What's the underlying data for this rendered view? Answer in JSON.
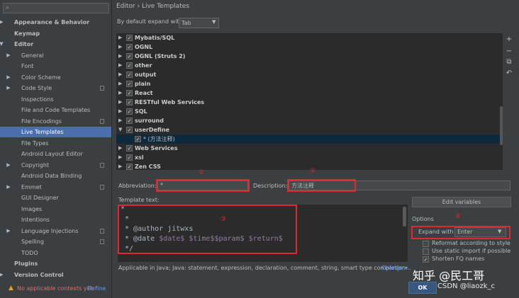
{
  "sidebar": {
    "search_icon": "magnifier-icon",
    "items": [
      {
        "label": "Appearance & Behavior",
        "arrow": "▶"
      },
      {
        "label": "Keymap",
        "arrow": ""
      },
      {
        "label": "Editor",
        "arrow": "▼"
      },
      {
        "label": "General",
        "arrow": "▶"
      },
      {
        "label": "Font",
        "arrow": ""
      },
      {
        "label": "Color Scheme",
        "arrow": "▶"
      },
      {
        "label": "Code Style",
        "arrow": "▶"
      },
      {
        "label": "Inspections",
        "arrow": ""
      },
      {
        "label": "File and Code Templates",
        "arrow": ""
      },
      {
        "label": "File Encodings",
        "arrow": ""
      },
      {
        "label": "Live Templates",
        "arrow": ""
      },
      {
        "label": "File Types",
        "arrow": ""
      },
      {
        "label": "Android Layout Editor",
        "arrow": ""
      },
      {
        "label": "Copyright",
        "arrow": "▶"
      },
      {
        "label": "Android Data Binding",
        "arrow": ""
      },
      {
        "label": "Emmet",
        "arrow": "▶"
      },
      {
        "label": "GUI Designer",
        "arrow": ""
      },
      {
        "label": "Images",
        "arrow": ""
      },
      {
        "label": "Intentions",
        "arrow": ""
      },
      {
        "label": "Language Injections",
        "arrow": "▶"
      },
      {
        "label": "Spelling",
        "arrow": ""
      },
      {
        "label": "TODO",
        "arrow": ""
      },
      {
        "label": "Plugins",
        "arrow": ""
      },
      {
        "label": "Version Control",
        "arrow": "▶"
      }
    ],
    "warning_text": "No applicable contexts yet.",
    "warning_link": "Define"
  },
  "breadcrumb": "Editor  ›  Live Templates",
  "expand_label": "By default expand with",
  "expand_value": "Tab",
  "tree": [
    {
      "label": "Mybatis/SQL"
    },
    {
      "label": "OGNL"
    },
    {
      "label": "OGNL (Struts 2)"
    },
    {
      "label": "other"
    },
    {
      "label": "output"
    },
    {
      "label": "plain"
    },
    {
      "label": "React"
    },
    {
      "label": "RESTful Web Services"
    },
    {
      "label": "SQL"
    },
    {
      "label": "surround"
    },
    {
      "label": "userDefine"
    },
    {
      "label": "* (方法注释)"
    },
    {
      "label": "Web Services"
    },
    {
      "label": "xsl"
    },
    {
      "label": "Zen CSS"
    }
  ],
  "tools": [
    "+",
    "−",
    "⧉",
    "↶"
  ],
  "abbreviation_label": "Abbreviation:",
  "abbreviation_value": "*",
  "description_label": "Description:",
  "description_value": "方法注释",
  "template_label": "Template text:",
  "template_lines": [
    "*",
    " *",
    " * @author jitwxs",
    " * @date ",
    " */"
  ],
  "template_vars": [
    "$date$",
    "$time$",
    "$param$",
    "$return$"
  ],
  "markers": [
    "①",
    "②",
    "③",
    "④"
  ],
  "edit_vars": "Edit variables",
  "options_label": "Options",
  "expand_with_label": "Expand with",
  "expand_with_value": "Enter",
  "options": [
    {
      "label": "Reformat according to style",
      "checked": false,
      "disabled": false
    },
    {
      "label": "Use static import if possible",
      "checked": false,
      "disabled": false
    },
    {
      "label": "Shorten FQ names",
      "checked": true,
      "disabled": false
    }
  ],
  "applicable_text": "Applicable in Java; Java: statement, expression, declaration, comment, string, smart type completion...",
  "change_link": "Change ▾",
  "ok_label": "OK",
  "watermark_main": "知乎 @民工哥",
  "watermark_sub": "CSDN @liaozk_c",
  "colors": {
    "accent": "#4b6eaf",
    "red": "#e0282e",
    "bg": "#3c3f41",
    "panel": "#2b2b2b"
  }
}
